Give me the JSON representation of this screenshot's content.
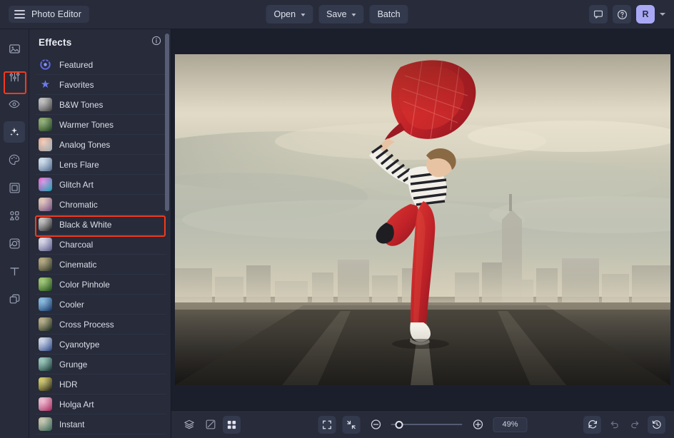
{
  "app": {
    "title": "Photo Editor",
    "menu_icon": "hamburger-icon"
  },
  "topbar": {
    "open_label": "Open",
    "save_label": "Save",
    "batch_label": "Batch",
    "feedback_icon": "comment-icon",
    "help_icon": "question-circle-icon",
    "avatar_initial": "R",
    "avatar_color": "#a8a8f5"
  },
  "rail": {
    "items": [
      {
        "name": "image-icon",
        "label": "Image",
        "active": false
      },
      {
        "name": "adjust-sliders-icon",
        "label": "Adjust",
        "active": false
      },
      {
        "name": "eye-retouch-icon",
        "label": "Retouch",
        "active": false
      },
      {
        "name": "sparkles-effects-icon",
        "label": "Effects",
        "active": true
      },
      {
        "name": "palette-paint-icon",
        "label": "Paint",
        "active": false
      },
      {
        "name": "frame-icon",
        "label": "Frames",
        "active": false
      },
      {
        "name": "shapes-icon",
        "label": "Shapes",
        "active": false
      },
      {
        "name": "overlay-icon",
        "label": "Overlays",
        "active": false
      },
      {
        "name": "text-tool-icon",
        "label": "Text",
        "active": false
      },
      {
        "name": "layers-duplicate-icon",
        "label": "Layers",
        "active": false
      }
    ]
  },
  "panel": {
    "title": "Effects",
    "info_icon": "info-circle-icon",
    "selected": "Black & White",
    "items": [
      {
        "label": "Featured",
        "thumb": "featured-badge-icon",
        "c1": "#4450b8",
        "c2": "#6f7ce8"
      },
      {
        "label": "Favorites",
        "thumb": "star-icon",
        "c1": "#5a6ae8",
        "c2": "#8a96f5"
      },
      {
        "label": "B&W Tones",
        "thumb": "bw-face-thumbnail",
        "c1": "#c9c9c9",
        "c2": "#4a4a4a"
      },
      {
        "label": "Warmer Tones",
        "thumb": "leaves-thumbnail",
        "c1": "#7ea84b",
        "c2": "#1e4a21"
      },
      {
        "label": "Analog Tones",
        "thumb": "flamingo-thumbnail",
        "c1": "#f4a07a",
        "c2": "#cfe3ea"
      },
      {
        "label": "Lens Flare",
        "thumb": "flare-thumbnail",
        "c1": "#dff0ff",
        "c2": "#5c7fae"
      },
      {
        "label": "Glitch Art",
        "thumb": "glitch-thumbnail",
        "c1": "#ff3bd0",
        "c2": "#1ad6e8"
      },
      {
        "label": "Chromatic",
        "thumb": "chromatic-thumbnail",
        "c1": "#f3cfa4",
        "c2": "#8e5ba8"
      },
      {
        "label": "Black & White",
        "thumb": "blackwhite-thumbnail",
        "c1": "#d8d8d8",
        "c2": "#1a1a1a"
      },
      {
        "label": "Charcoal",
        "thumb": "charcoal-thumbnail",
        "c1": "#eceaf4",
        "c2": "#6a6ab0"
      },
      {
        "label": "Cinematic",
        "thumb": "cinematic-thumbnail",
        "c1": "#b8a05a",
        "c2": "#2d3a2a"
      },
      {
        "label": "Color Pinhole",
        "thumb": "pinhole-thumbnail",
        "c1": "#9ad24a",
        "c2": "#1c5c18"
      },
      {
        "label": "Cooler",
        "thumb": "cooler-thumbnail",
        "c1": "#6fc0f5",
        "c2": "#123a7a"
      },
      {
        "label": "Cross Process",
        "thumb": "crossprocess-thumbnail",
        "c1": "#c8b070",
        "c2": "#102818"
      },
      {
        "label": "Cyanotype",
        "thumb": "cyanotype-thumbnail",
        "c1": "#e8eef8",
        "c2": "#2c52a8"
      },
      {
        "label": "Grunge",
        "thumb": "grunge-thumbnail",
        "c1": "#8fd8c0",
        "c2": "#0e3a38"
      },
      {
        "label": "HDR",
        "thumb": "hdr-thumbnail",
        "c1": "#f0e040",
        "c2": "#1c1c10"
      },
      {
        "label": "Holga Art",
        "thumb": "holga-thumbnail",
        "c1": "#f6c8dc",
        "c2": "#d82a72"
      },
      {
        "label": "Instant",
        "thumb": "instant-thumbnail",
        "c1": "#d8c8a0",
        "c2": "#3a7a6a"
      }
    ],
    "scrollbar": "panel-scrollbar"
  },
  "canvas": {
    "photo_alt": "dancer-with-red-scarf-city-skyline-photo"
  },
  "bottombar": {
    "left_tools": [
      {
        "name": "layers-stack-icon",
        "label": "Layers",
        "filled": false
      },
      {
        "name": "compare-split-icon",
        "label": "Compare",
        "filled": false
      },
      {
        "name": "grid-view-icon",
        "label": "Grid",
        "filled": true
      }
    ],
    "fit_icon": "fit-to-screen-icon",
    "fill_icon": "actual-size-icon",
    "zoom_out_icon": "zoom-out-icon",
    "zoom_in_icon": "zoom-in-icon",
    "zoom_value": "49%",
    "slider_name": "zoom-slider",
    "right_tools": [
      {
        "name": "reset-icon",
        "label": "Reset",
        "filled": true,
        "dim": false
      },
      {
        "name": "undo-icon",
        "label": "Undo",
        "filled": false,
        "dim": true
      },
      {
        "name": "redo-icon",
        "label": "Redo",
        "filled": false,
        "dim": true
      },
      {
        "name": "history-icon",
        "label": "History",
        "filled": true,
        "dim": false
      }
    ]
  },
  "annotations": {
    "effects_rail_highlight": "sparkles-effects-icon",
    "blackwhite_row_highlight": "Black & White",
    "color": "#f6391a"
  }
}
